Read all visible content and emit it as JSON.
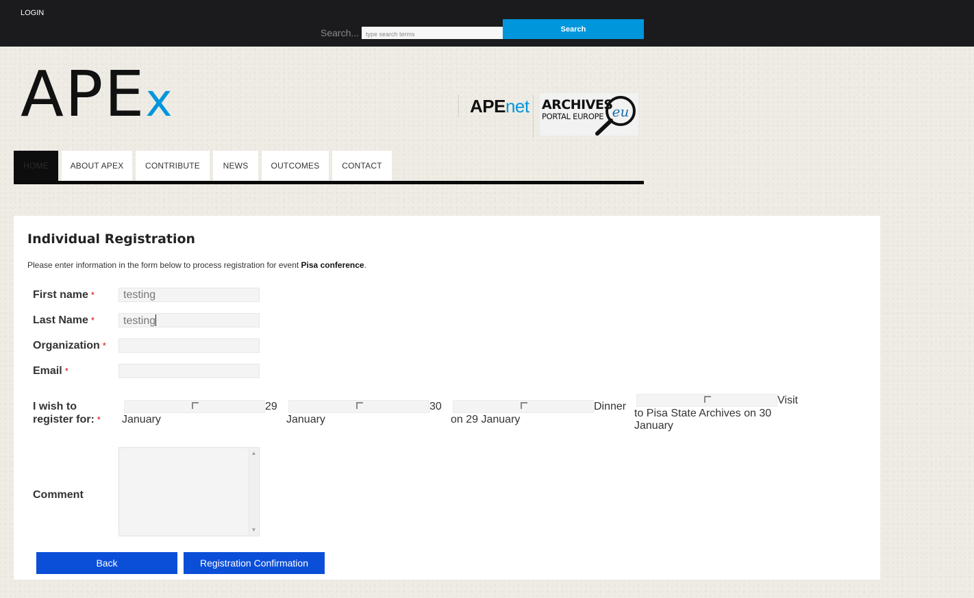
{
  "topbar": {
    "login_label": "LOGIN",
    "search_label": "Search...",
    "search_placeholder": "type search terms",
    "search_button": "Search"
  },
  "branding": {
    "main_logo_text": "APE",
    "main_logo_accent": "x",
    "partner1_text": "APE",
    "partner1_accent": "net",
    "partner2_line1": "ARCHIVES",
    "partner2_line2": "PORTAL EUROPE",
    "partner2_badge": "eu",
    "accent_color": "#0096dc"
  },
  "nav": {
    "items": [
      {
        "label": "HOME",
        "active": true
      },
      {
        "label": "ABOUT APEX",
        "active": false
      },
      {
        "label": "CONTRIBUTE",
        "active": false
      },
      {
        "label": "NEWS",
        "active": false
      },
      {
        "label": "OUTCOMES",
        "active": false
      },
      {
        "label": "CONTACT",
        "active": false
      }
    ]
  },
  "form": {
    "title": "Individual Registration",
    "intro_prefix": "Please enter information in the form below to process registration for event ",
    "event_name": "Pisa conference",
    "intro_suffix": ".",
    "required_mark": "*",
    "fields": {
      "first_name": {
        "label": "First name",
        "value": "testing"
      },
      "last_name": {
        "label": "Last Name",
        "value": "testing"
      },
      "organization": {
        "label": "Organization",
        "value": ""
      },
      "email": {
        "label": "Email",
        "value": ""
      }
    },
    "register_for": {
      "label_line1": "I wish to",
      "label_line2": "register for:",
      "options": [
        {
          "tail": "29",
          "rest": "January",
          "checked": false
        },
        {
          "tail": "30",
          "rest": "January",
          "checked": false
        },
        {
          "tail": "Dinner",
          "rest": "on 29 January",
          "checked": false
        },
        {
          "tail": "Visit",
          "rest": "to Pisa State Archives on 30",
          "rest2": "January",
          "checked": false
        }
      ]
    },
    "comment": {
      "label": "Comment",
      "value": ""
    },
    "buttons": {
      "back": "Back",
      "confirm": "Registration Confirmation"
    },
    "button_color": "#0b4fd8"
  }
}
